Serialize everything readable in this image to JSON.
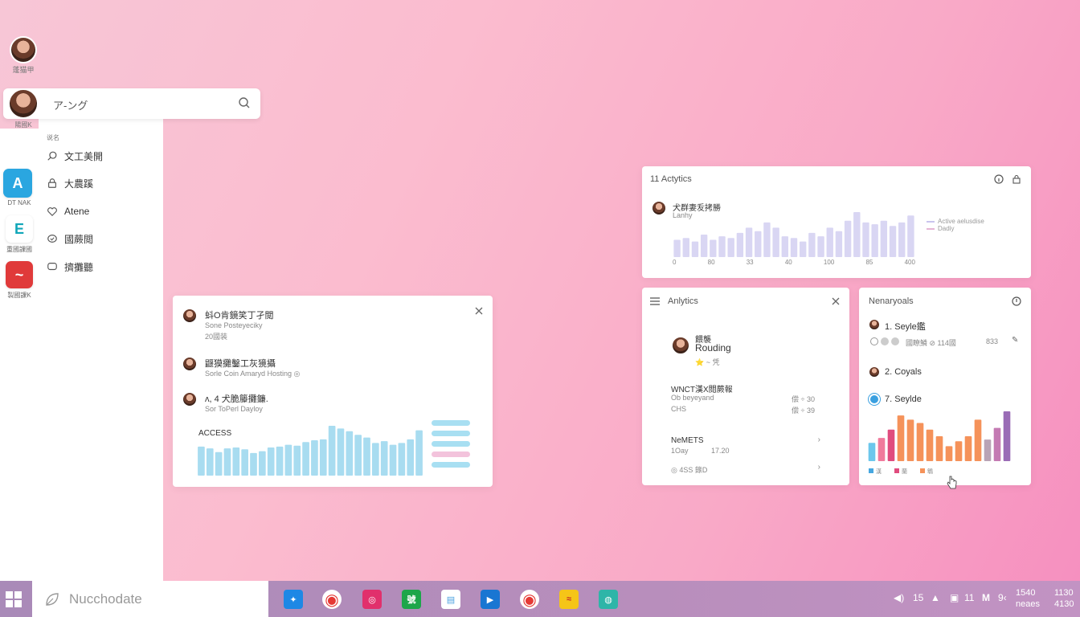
{
  "profile": {
    "label": "蓬猫甲"
  },
  "search": {
    "text": "ア-ング",
    "avatar_label": "陽國K"
  },
  "left_rail": {
    "apps": [
      {
        "label": "DT NAK",
        "color": "#2aa6e0",
        "glyph": "A"
      },
      {
        "label": "重國課國",
        "color": "#10a6b8",
        "glyph": "E"
      },
      {
        "label": "製國課K",
        "color": "#e03a3a",
        "glyph": "~"
      }
    ]
  },
  "sidebar_menu": {
    "header": "说名",
    "items": [
      {
        "label": "文工美開",
        "icon": "search-icon"
      },
      {
        "label": "大農蹊",
        "icon": "lock-icon"
      },
      {
        "label": "Atene",
        "icon": "heart-icon"
      },
      {
        "label": "國蕨閲",
        "icon": "chat-icon"
      },
      {
        "label": "擠攤聽",
        "icon": "message-icon"
      }
    ]
  },
  "activity_card": {
    "rows": [
      {
        "title": "蚪O肯鏡笑丁孑閲",
        "subtitle1": "Sone Posteyeciky",
        "subtitle2": "20國装"
      },
      {
        "title": "鼴獏攤鑿工灰獍攝",
        "subtitle1": "Sorle Coin Amaryd Hosting ◎"
      },
      {
        "title": "ᴧ, 4 犬脆籐攤鐮.",
        "subtitle1": "Sor ToPerl Dayloy"
      }
    ],
    "chart_label": "ACCESS",
    "chart_values": [
      32,
      30,
      26,
      30,
      31,
      29,
      25,
      27,
      31,
      32,
      34,
      33,
      37,
      39,
      40,
      55,
      52,
      49,
      45,
      42,
      36,
      38,
      34,
      36,
      40,
      50
    ]
  },
  "analytics_top": {
    "title": "11 Actytics",
    "user_name": "犬群妻叐拷勝",
    "user_sub": "Lanhy",
    "legend": [
      "Active aelusdise",
      "Dadiy"
    ],
    "x_ticks": [
      "0",
      "80",
      "33",
      "40",
      "100",
      "85",
      "400"
    ],
    "bars": [
      20,
      22,
      18,
      26,
      20,
      24,
      22,
      28,
      34,
      30,
      40,
      34,
      24,
      22,
      18,
      28,
      24,
      34,
      30,
      42,
      52,
      40,
      38,
      42,
      36,
      40,
      48
    ]
  },
  "analytics_mid": {
    "title": "Anlytics",
    "user_label": "餵襲",
    "user_name": "Rouding",
    "user_meta": "⭐ ~ 凭",
    "section1_title": "WNCT漢X閲蕨報",
    "section1_row1_left": "Ob beyeyand",
    "section1_row1_right": "偿 ÷ 30",
    "section1_row2_left": "CHS",
    "section1_row2_right": "偿 ÷ 39",
    "section2_title": "NeMETS",
    "section2_left": "1Oay",
    "section2_right": "17.20",
    "section3": "◎ 4SS 錄D"
  },
  "nearby_goals": {
    "title": "Nenaryoals",
    "item1": "1. Seyle鑑",
    "item1_meta": "國瞭鱗 ⊘ 114國",
    "item1_count": "833",
    "item2": "2. Coyals",
    "item3": "7. Seylde",
    "bars": [
      {
        "value": 22,
        "color": "#6cc7ec"
      },
      {
        "value": 28,
        "color": "#f07a9c"
      },
      {
        "value": 38,
        "color": "#e04c7e"
      },
      {
        "value": 55,
        "color": "#f5925a"
      },
      {
        "value": 50,
        "color": "#f5925a"
      },
      {
        "value": 46,
        "color": "#f5925a"
      },
      {
        "value": 38,
        "color": "#f5925a"
      },
      {
        "value": 30,
        "color": "#f5925a"
      },
      {
        "value": 18,
        "color": "#f5925a"
      },
      {
        "value": 24,
        "color": "#f5925a"
      },
      {
        "value": 30,
        "color": "#f5925a"
      },
      {
        "value": 50,
        "color": "#f5925a"
      },
      {
        "value": 26,
        "color": "#b9a3b5"
      },
      {
        "value": 40,
        "color": "#c47ab3"
      },
      {
        "value": 60,
        "color": "#9a6cb6"
      }
    ],
    "legend": [
      {
        "label": "漢",
        "color": "#46a7e0"
      },
      {
        "label": "蘭",
        "color": "#e04c7e"
      },
      {
        "label": "鵯",
        "color": "#f5925a"
      }
    ]
  },
  "taskbar": {
    "search_text": "Nucchodate",
    "apps": [
      {
        "name": "runner",
        "color": "#1e88e5",
        "glyph": "✦"
      },
      {
        "name": "chrome",
        "color": "#e53935",
        "glyph": "◉"
      },
      {
        "name": "instagram",
        "color": "#e1306c",
        "glyph": "◎"
      },
      {
        "name": "green-app",
        "color": "#1da64a",
        "glyph": "號"
      },
      {
        "name": "store",
        "color": "#4aa0e0",
        "glyph": "▤"
      },
      {
        "name": "blue-app",
        "color": "#1976d2",
        "glyph": "▶"
      },
      {
        "name": "chrome-2",
        "color": "#e53935",
        "glyph": "◉"
      },
      {
        "name": "yellow-app",
        "color": "#f5c518",
        "glyph": "≈"
      },
      {
        "name": "globe-app",
        "color": "#2eb5a8",
        "glyph": "◍"
      }
    ],
    "tray_15": "15",
    "tray_11": "11",
    "tray_9": "9‹",
    "time_top": "1540",
    "time_bottom": "neaes",
    "date_top": "1130",
    "date_bottom": "4130"
  }
}
